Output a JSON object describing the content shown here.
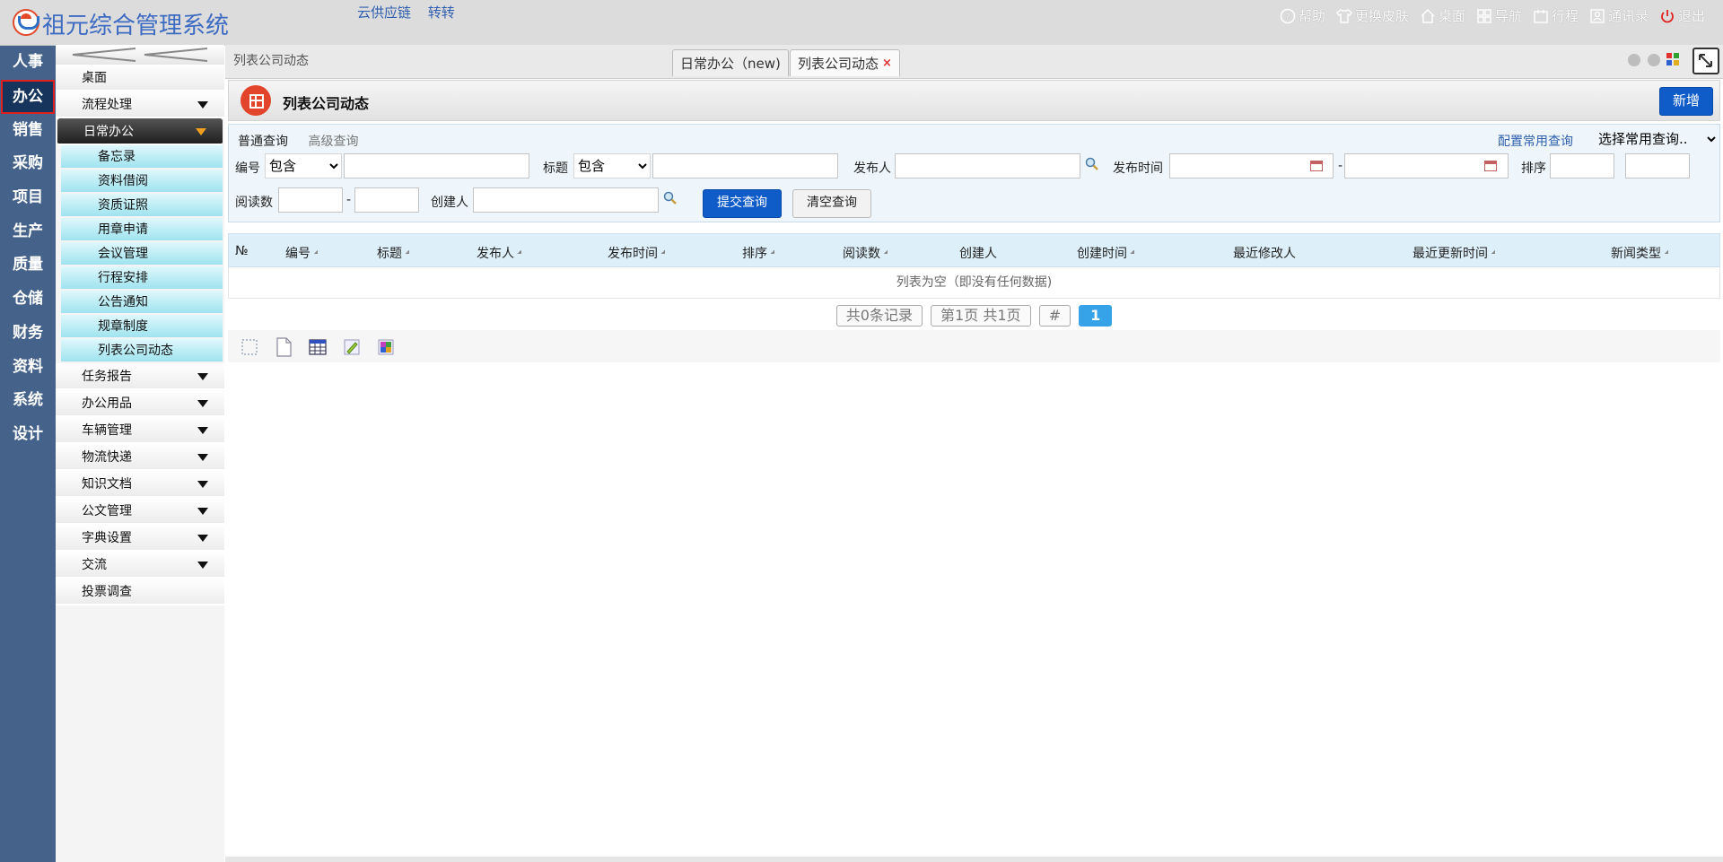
{
  "header": {
    "app_title": "祖元综合管理系统",
    "links": [
      "云供应链",
      "转转"
    ],
    "right_items": [
      {
        "icon": "help-icon",
        "label": "帮助"
      },
      {
        "icon": "shirt-icon",
        "label": "更换皮肤"
      },
      {
        "icon": "home-icon",
        "label": "桌面"
      },
      {
        "icon": "grid-icon",
        "label": "导航"
      },
      {
        "icon": "calendar-icon",
        "label": "行程"
      },
      {
        "icon": "contacts-icon",
        "label": "通讯录"
      },
      {
        "icon": "power-icon",
        "label": "退出"
      }
    ]
  },
  "left_nav": {
    "items": [
      "人事",
      "办公",
      "销售",
      "采购",
      "项目",
      "生产",
      "质量",
      "仓储",
      "财务",
      "资料",
      "系统",
      "设计"
    ],
    "active": "办公"
  },
  "side_menu": {
    "items_top": [
      "桌面",
      "流程处理"
    ],
    "open_group": "日常办公",
    "sub_items": [
      "备忘录",
      "资料借阅",
      "资质证照",
      "用章申请",
      "会议管理",
      "行程安排",
      "公告通知",
      "规章制度",
      "列表公司动态"
    ],
    "items_bottom": [
      "任务报告",
      "办公用品",
      "车辆管理",
      "物流快递",
      "知识文档",
      "公文管理",
      "字典设置",
      "交流",
      "投票调查"
    ]
  },
  "tabs": {
    "breadcrumb": "列表公司动态",
    "tab1": "日常办公（new)",
    "tab2": "列表公司动态",
    "close": "×"
  },
  "page": {
    "title": "列表公司动态",
    "add_button": "新增"
  },
  "search": {
    "tab_normal": "普通查询",
    "tab_advanced": "高级查询",
    "config_link": "配置常用查询",
    "preset_select": "选择常用查询..",
    "label_no": "编号",
    "label_title": "标题",
    "label_publisher": "发布人",
    "label_pubtime": "发布时间",
    "label_sort": "排序",
    "label_reads": "阅读数",
    "label_creator": "创建人",
    "op_contains": "包含",
    "dash": "-",
    "submit": "提交查询",
    "clear": "清空查询"
  },
  "grid": {
    "columns": [
      "№",
      "编号",
      "标题",
      "发布人",
      "发布时间",
      "排序",
      "阅读数",
      "创建人",
      "创建时间",
      "最近修改人",
      "最近更新时间",
      "新闻类型"
    ],
    "empty_text": "列表为空（即没有任何数据)"
  },
  "pager": {
    "total": "共0条记录",
    "page_info": "第1页 共1页",
    "hash": "#",
    "current": "1"
  },
  "colors": {
    "accent_blue": "#0f5bc8",
    "nav_bg": "#45628a",
    "active_border": "#e02020"
  }
}
